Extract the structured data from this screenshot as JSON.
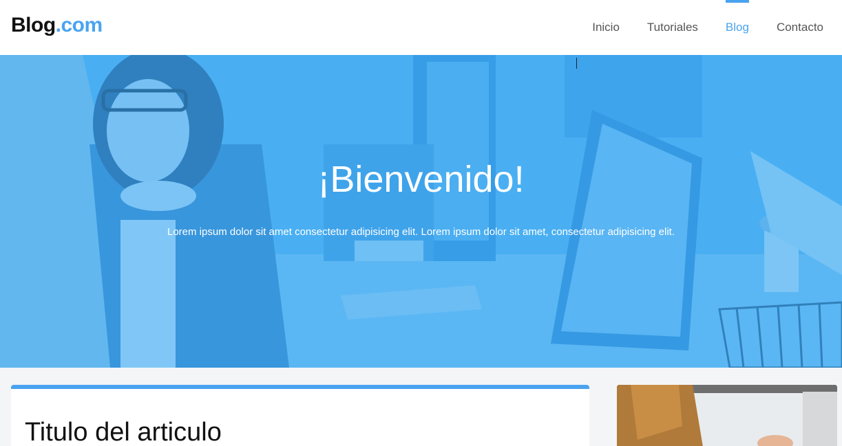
{
  "header": {
    "logo_main": "Blog",
    "logo_accent": ".com",
    "nav": [
      {
        "label": "Inicio",
        "active": false
      },
      {
        "label": "Tutoriales",
        "active": false
      },
      {
        "label": "Blog",
        "active": true
      },
      {
        "label": "Contacto",
        "active": false
      }
    ]
  },
  "hero": {
    "title": "¡Bienvenido!",
    "text": "Lorem ipsum dolor sit amet consectetur adipisicing elit. Lorem ipsum dolor sit amet, consectetur adipisicing elit."
  },
  "article": {
    "title": "Titulo del articulo"
  },
  "colors": {
    "accent": "#4aa3f0",
    "hero_overlay": "#40aaf0"
  }
}
